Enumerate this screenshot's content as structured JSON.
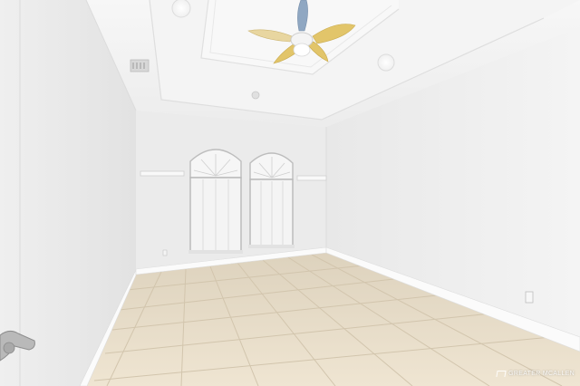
{
  "watermark": {
    "text": "GREATER MCALLEN"
  },
  "colors": {
    "wall_left": "#e6e6e6",
    "wall_back": "#ededed",
    "wall_right": "#ececec",
    "ceiling": "#f3f3f3",
    "tray": "#f7f7f7",
    "floor": "#e8dcc6",
    "grout": "#cfc2aa",
    "baseboard": "#fafafa",
    "fan_blade": "#e2c56a",
    "fan_blade_alt": "#8fa7c2"
  }
}
